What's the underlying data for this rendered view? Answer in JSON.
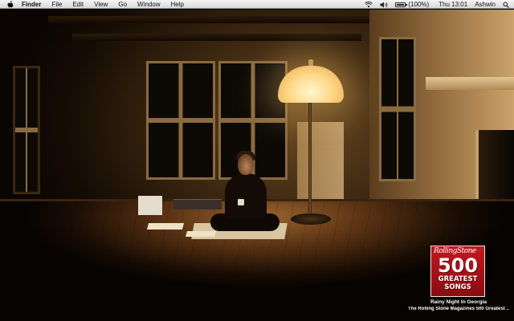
{
  "menubar": {
    "apple_icon": "apple-logo-icon",
    "app_name": "Finder",
    "menus": [
      "File",
      "Edit",
      "View",
      "Go",
      "Window",
      "Help"
    ],
    "status": {
      "wifi_icon": "wifi-icon",
      "volume_icon": "speaker-volume-icon",
      "battery_icon": "battery-icon",
      "battery_level": 1.0,
      "battery_text": "(100%)",
      "clock": "Thu 13:01",
      "user": "Ashwin",
      "search_icon": "spotlight-search-icon"
    }
  },
  "desktop": {
    "wallpaper": "dim-room-floor-lamp-photo"
  },
  "now_playing": {
    "cover": {
      "masthead": "RollingStone",
      "number": "500",
      "line1": "GREATEST",
      "line2": "SONGS"
    },
    "track_title": "Rainy Night In Georgia",
    "album_title": "The Rolling Stone Magazines 500 Greatest ..."
  },
  "colors": {
    "menubar_bg": "#e6e6e6",
    "album_red": "#c2171e",
    "lamp_glow": "#ffd98a"
  }
}
